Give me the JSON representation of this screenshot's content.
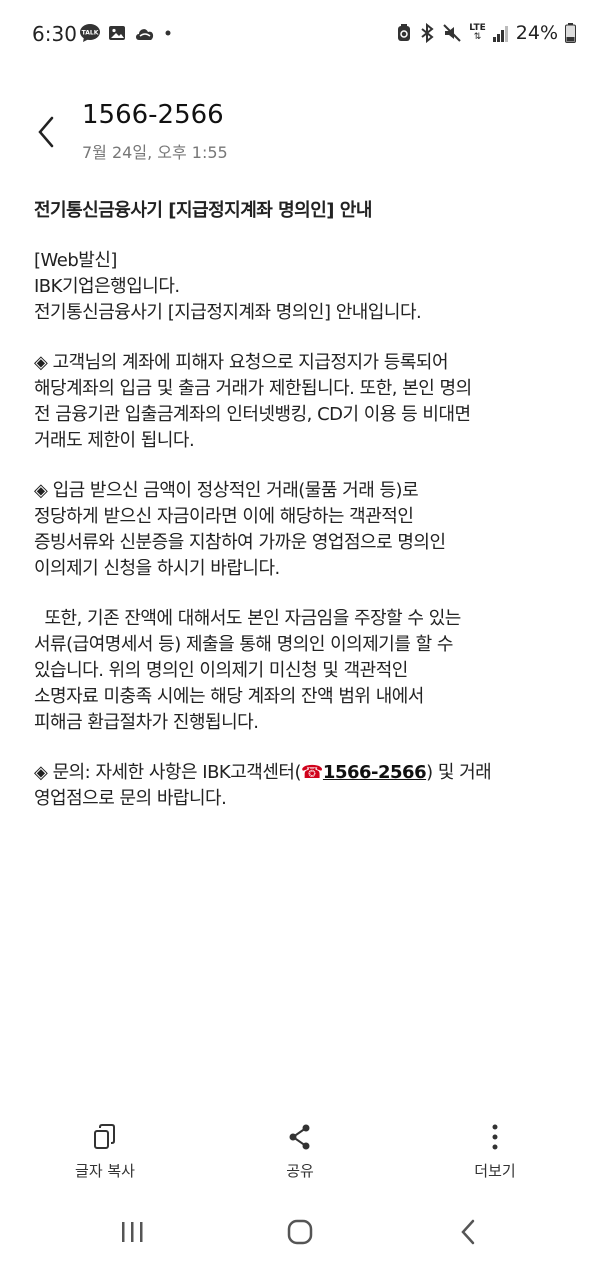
{
  "status_bar": {
    "time": "6:30",
    "left_icons": [
      "talk-icon",
      "image-icon",
      "cloud-icon",
      "dot-icon"
    ],
    "right_icons": [
      "sync-icon",
      "bluetooth-icon",
      "mute-icon",
      "lte-icon",
      "signal-icon",
      "battery-icon"
    ],
    "lte_label": "LTE",
    "battery": "24%"
  },
  "header": {
    "sender": "1566-2566",
    "date": "7월 24일, 오후 1:55"
  },
  "message": {
    "title": "전기통신금융사기 [지급정지계좌 명의인] 안내",
    "intro": [
      "[Web발신]",
      "IBK기업은행입니다.",
      "전기통신금융사기 [지급정지계좌 명의인] 안내입니다."
    ],
    "para1": [
      "◈ 고객님의 계좌에 피해자 요청으로 지급정지가 등록되어",
      "해당계좌의 입금 및 출금 거래가 제한됩니다. 또한, 본인 명의",
      "전 금융기관 입출금계좌의 인터넷뱅킹, CD기 이용 등 비대면",
      "거래도 제한이 됩니다."
    ],
    "para2": [
      "◈ 입금 받으신 금액이 정상적인 거래(물품 거래 등)로",
      "정당하게 받으신 자금이라면 이에 해당하는 객관적인",
      "증빙서류와 신분증을 지참하여 가까운 영업점으로 명의인",
      "이의제기 신청을 하시기 바랍니다."
    ],
    "para3": [
      "  또한, 기존 잔액에 대해서도 본인 자금임을 주장할 수 있는",
      "서류(급여명세서 등) 제출을 통해 명의인 이의제기를 할 수",
      "있습니다. 위의 명의인 이의제기 미신청 및 객관적인",
      "소명자료 미충족 시에는 해당 계좌의 잔액 범위 내에서",
      "피해금 환급절차가 진행됩니다."
    ],
    "contact_prefix": "◈ 문의: 자세한 사항은 IBK고객센터(",
    "contact_phone_emoji": "☎",
    "contact_phone": "1566-2566",
    "contact_suffix": ") 및 거래",
    "contact_line2": "영업점으로 문의 바랍니다."
  },
  "actions": {
    "copy_label": "글자 복사",
    "share_label": "공유",
    "more_label": "더보기",
    "copy_icon": "copy-icon",
    "share_icon": "share-icon",
    "more_icon": "more-vertical-icon"
  },
  "nav": {
    "recent_icon": "recent-apps-icon",
    "home_icon": "home-icon",
    "back_icon": "back-icon"
  },
  "colors": {
    "text": "#222222",
    "muted": "#777777",
    "phone_emoji": "#d0021b"
  }
}
